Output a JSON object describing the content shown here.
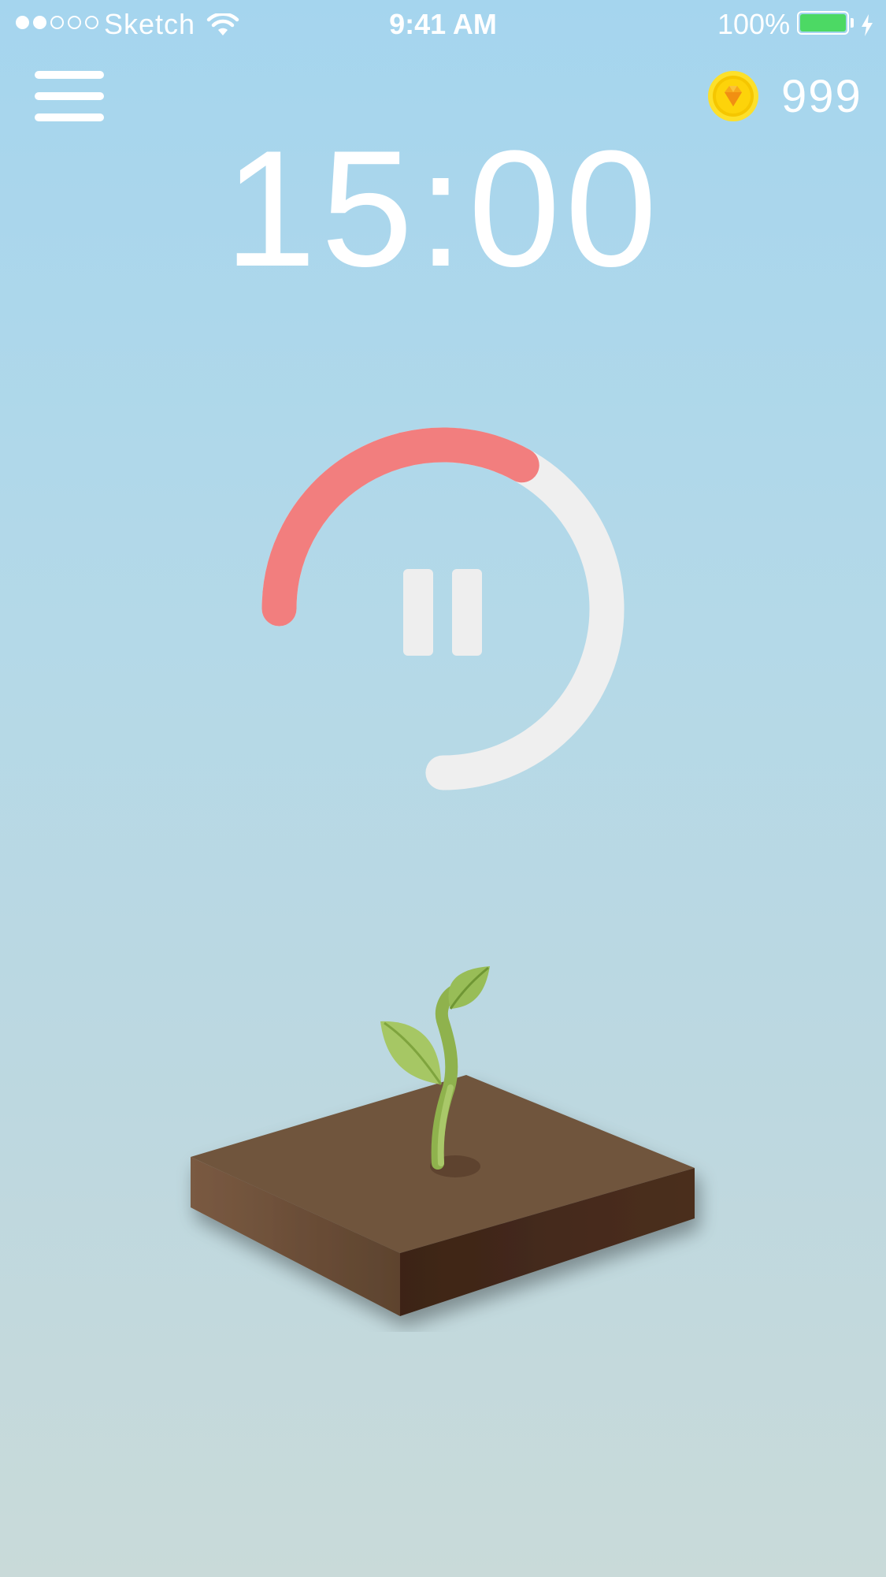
{
  "status_bar": {
    "carrier": "Sketch",
    "time": "9:41 AM",
    "battery_percent": "100%",
    "signal_bars_filled": 2,
    "signal_bars_total": 5,
    "battery_level": 1.0,
    "battery_color": "#4cd964",
    "charging": true,
    "icons": [
      "signal-dots-icon",
      "wifi-icon",
      "battery-icon",
      "charging-bolt-icon"
    ]
  },
  "header": {
    "menu_icon": "hamburger-menu-icon",
    "coin_icon": "gold-coin-icon",
    "coin_count": "999"
  },
  "timer": {
    "remaining": "15:00",
    "progress_fraction": 0.33,
    "progress_color": "#f27e7e",
    "track_color": "#efefef",
    "control_icon": "pause-icon"
  },
  "scene": {
    "illustration": "sapling-on-soil-block",
    "soil_color": "#70553d",
    "leaf_color": "#a6c764"
  }
}
